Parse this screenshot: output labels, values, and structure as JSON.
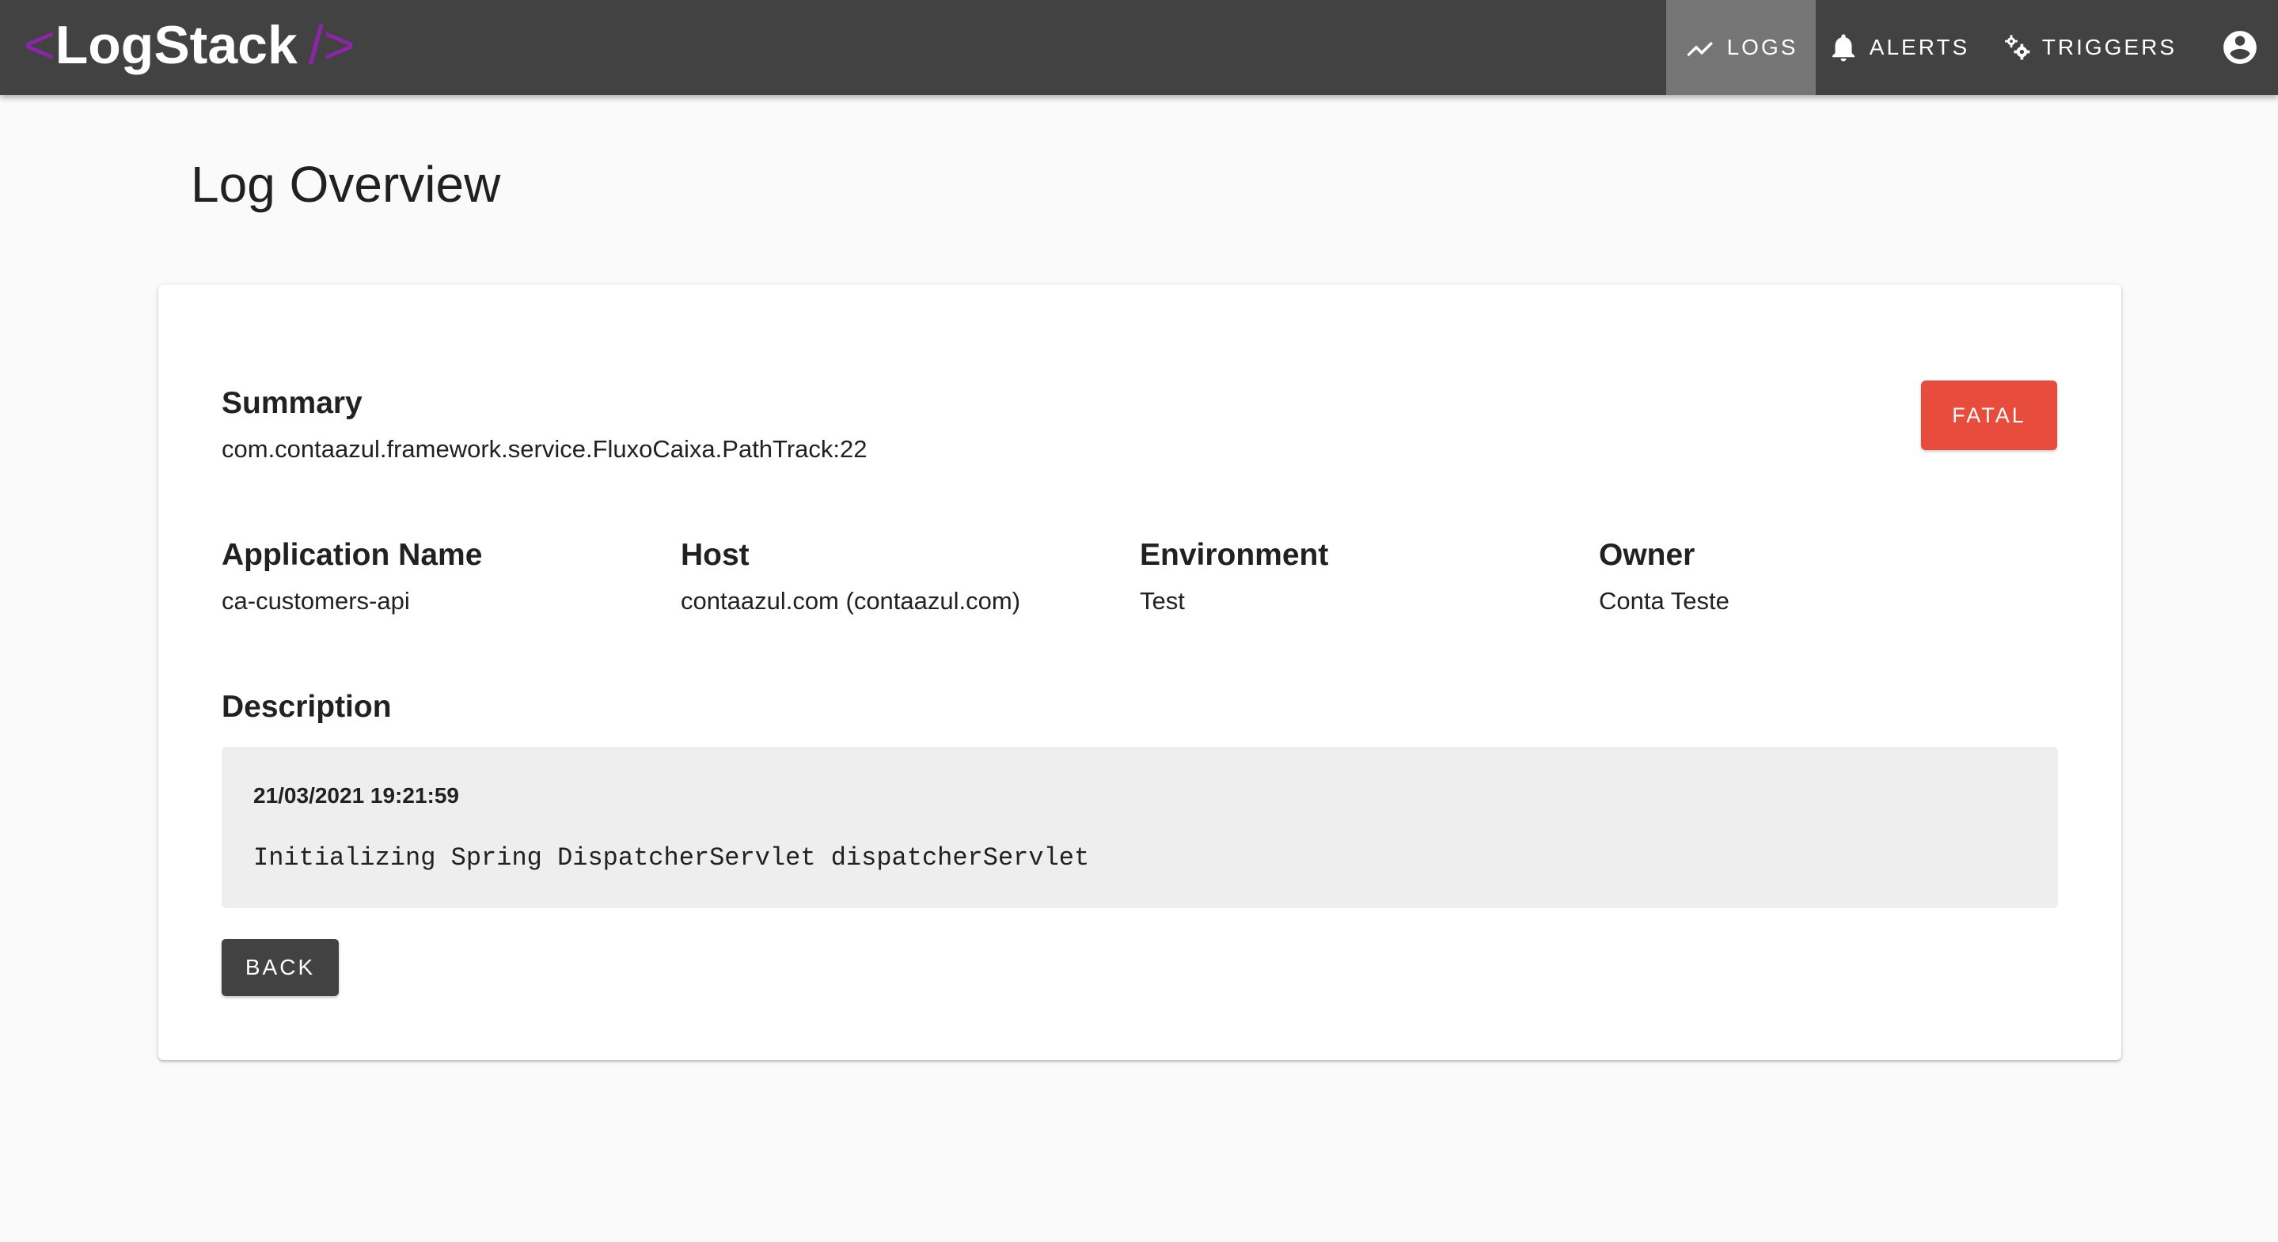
{
  "app": {
    "logo_open": "<",
    "logo_name": "LogStack",
    "logo_close": "/>",
    "accent_color": "#8e24aa",
    "appbar_color": "#424242"
  },
  "nav": {
    "items": [
      {
        "label": "LOGS",
        "icon": "trending-up-icon",
        "active": true
      },
      {
        "label": "ALERTS",
        "icon": "bell-icon",
        "active": false
      },
      {
        "label": "TRIGGERS",
        "icon": "gears-icon",
        "active": false
      }
    ],
    "account_icon": "account-circle-icon"
  },
  "page": {
    "title": "Log Overview"
  },
  "log": {
    "summary_label": "Summary",
    "summary_value": "com.contaazul.framework.service.FluxoCaixa.PathTrack:22",
    "level": "FATAL",
    "level_color": "#e74c3c",
    "fields": [
      {
        "label": "Application Name",
        "value": "ca-customers-api"
      },
      {
        "label": "Host",
        "value": "contaazul.com (contaazul.com)"
      },
      {
        "label": "Environment",
        "value": "Test"
      },
      {
        "label": "Owner",
        "value": "Conta Teste"
      }
    ],
    "description_label": "Description",
    "description_timestamp": "21/03/2021 19:21:59",
    "description_message": "Initializing Spring DispatcherServlet dispatcherServlet"
  },
  "actions": {
    "back_label": "BACK"
  }
}
